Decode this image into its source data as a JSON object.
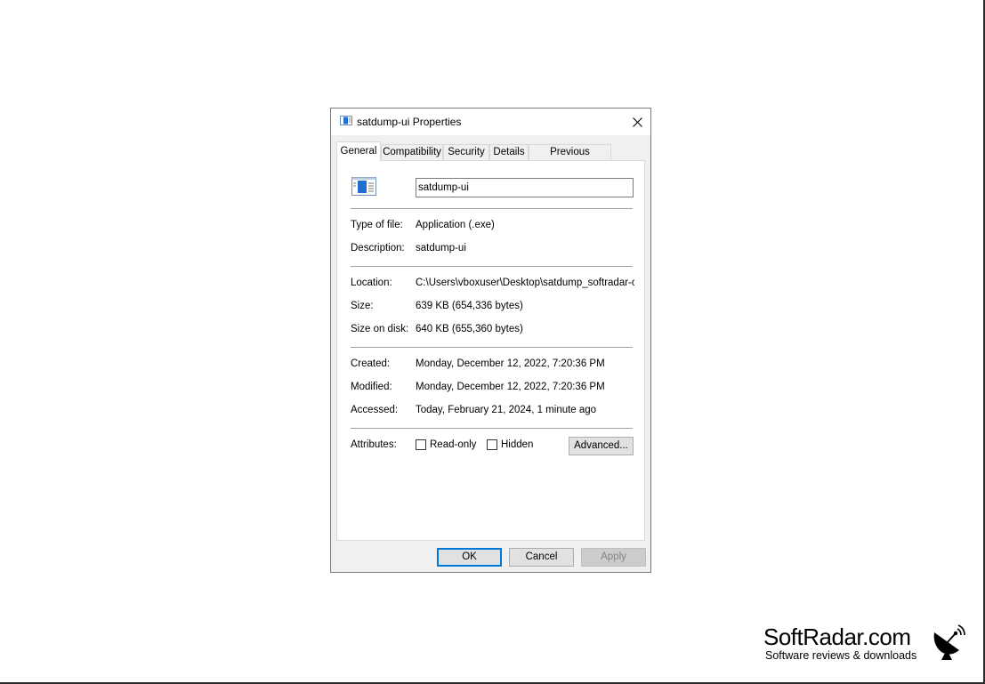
{
  "dialog": {
    "title": "satdump-ui Properties",
    "close_symbol": "✕",
    "tabs": [
      "General",
      "Compatibility",
      "Security",
      "Details",
      "Previous Versions"
    ],
    "active_tab": "General",
    "icons": {
      "title": "application-icon",
      "file": "application-icon",
      "close": "close-icon"
    }
  },
  "general": {
    "file_name": "satdump-ui",
    "type_of_file": {
      "label": "Type of file:",
      "value": "Application (.exe)"
    },
    "description": {
      "label": "Description:",
      "value": "satdump-ui"
    },
    "location": {
      "label": "Location:",
      "value": "C:\\Users\\vboxuser\\Desktop\\satdump_softradar-com"
    },
    "size": {
      "label": "Size:",
      "value": "639 KB (654,336 bytes)"
    },
    "size_on_disk": {
      "label": "Size on disk:",
      "value": "640 KB (655,360 bytes)"
    },
    "created": {
      "label": "Created:",
      "value": "Monday, December 12, 2022, 7:20:36 PM"
    },
    "modified": {
      "label": "Modified:",
      "value": "Monday, December 12, 2022, 7:20:36 PM"
    },
    "accessed": {
      "label": "Accessed:",
      "value": "Today, February 21, 2024, 1 minute ago"
    },
    "attributes": {
      "label": "Attributes:",
      "read_only": {
        "label": "Read-only",
        "checked": false
      },
      "hidden": {
        "label": "Hidden",
        "checked": false
      },
      "advanced_label": "Advanced..."
    }
  },
  "buttons": {
    "ok": "OK",
    "cancel": "Cancel",
    "apply": "Apply"
  },
  "watermark": {
    "name": "SoftRadar.com",
    "tagline": "Software reviews & downloads",
    "icon": "satellite-dish-icon"
  },
  "colors": {
    "accent": "#0078d7",
    "dialog_bg": "#f0f0f0",
    "button_bg": "#e1e1e1"
  }
}
